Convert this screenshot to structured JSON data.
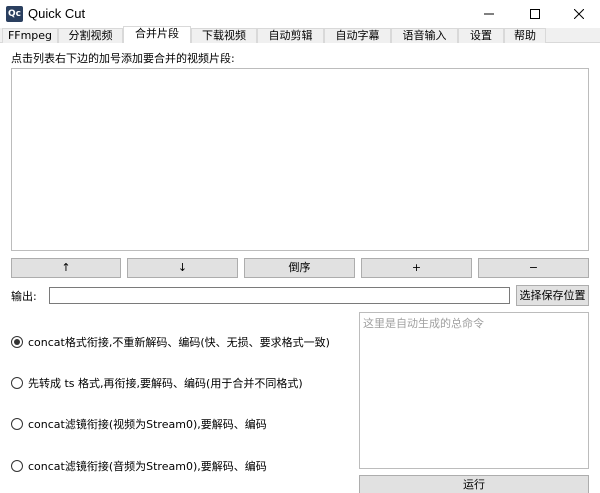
{
  "window": {
    "icon_text": "Qc",
    "title": "Quick Cut"
  },
  "tabs": [
    {
      "label": "FFmpeg",
      "active": false
    },
    {
      "label": "分割视频",
      "active": false
    },
    {
      "label": "合并片段",
      "active": true
    },
    {
      "label": "下载视频",
      "active": false
    },
    {
      "label": "自动剪辑",
      "active": false
    },
    {
      "label": "自动字幕",
      "active": false
    },
    {
      "label": "语音输入",
      "active": false
    },
    {
      "label": "设置",
      "active": false
    },
    {
      "label": "帮助",
      "active": false
    }
  ],
  "merge": {
    "hint": "点击列表右下边的加号添加要合并的视频片段:",
    "buttons": {
      "up": "↑",
      "down": "↓",
      "reverse": "倒序",
      "add": "+",
      "remove": "−"
    },
    "output_label": "输出:",
    "output_value": "",
    "choose_location": "选择保存位置",
    "options": [
      {
        "label": "concat格式衔接,不重新解码、编码(快、无损、要求格式一致)",
        "checked": true
      },
      {
        "label": "先转成 ts 格式,再衔接,要解码、编码(用于合并不同格式)",
        "checked": false
      },
      {
        "label": "concat滤镜衔接(视频为Stream0),要解码、编码",
        "checked": false
      },
      {
        "label": "concat滤镜衔接(音频为Stream0),要解码、编码",
        "checked": false
      }
    ],
    "command_placeholder": "这里是自动生成的总命令",
    "run_label": "运行"
  }
}
